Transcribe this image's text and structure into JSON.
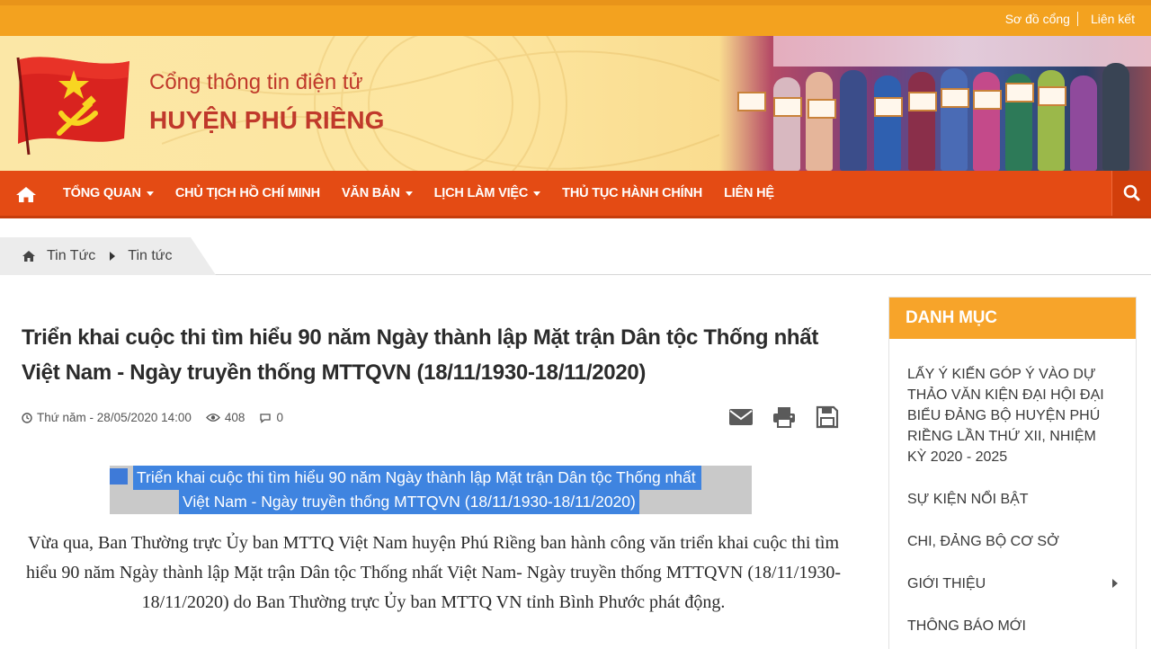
{
  "topbar": {
    "sitemap_label": "Sơ đồ cổng",
    "links_label": "Liên kết"
  },
  "header": {
    "subtitle": "Cổng thông tin điện tử",
    "title": "HUYỆN PHÚ RIỀNG"
  },
  "nav": {
    "items": [
      {
        "label": "TỔNG QUAN",
        "dropdown": true
      },
      {
        "label": "CHỦ TỊCH HỒ CHÍ MINH",
        "dropdown": false
      },
      {
        "label": "VĂN BẢN",
        "dropdown": true
      },
      {
        "label": "LỊCH LÀM VIỆC",
        "dropdown": true
      },
      {
        "label": "THỦ TỤC HÀNH CHÍNH",
        "dropdown": false
      },
      {
        "label": "LIÊN HỆ",
        "dropdown": false
      }
    ],
    "home_icon": "home-icon",
    "search_icon": "search-icon"
  },
  "breadcrumb": {
    "items": [
      "Tin Tức",
      "Tin tức"
    ]
  },
  "article": {
    "title": "Triển khai cuộc thi tìm hiểu 90 năm Ngày thành lập Mặt trận Dân tộc Thống nhất Việt Nam - Ngày truyền thống MTTQVN (18/11/1930-18/11/2020)",
    "date": "Thứ năm - 28/05/2020 14:00",
    "views": "408",
    "comments": "0",
    "highlight_line1": "Triển khai cuộc thi tìm hiểu 90 năm Ngày thành lập Mặt trận Dân tộc Thống nhất",
    "highlight_line2": "Việt Nam - Ngày truyền thống MTTQVN (18/11/1930-18/11/2020)",
    "body": "Vừa qua, Ban Thường trực Ủy ban MTTQ Việt Nam huyện Phú Riềng ban hành công văn triển khai cuộc thi tìm hiểu 90 năm Ngày thành lập Mặt trận Dân tộc Thống nhất Việt Nam- Ngày truyền thống MTTQVN (18/11/1930-18/11/2020) do Ban Thường trực Ủy ban MTTQ VN tỉnh Bình Phước phát động.",
    "highlight_color": "#3f84e0"
  },
  "sidebar": {
    "heading": "DANH MỤC",
    "items": [
      {
        "label": "LẤY Ý KIẾN GÓP Ý VÀO DỰ THẢO VĂN KIỆN ĐẠI HỘI ĐẠI BIỂU ĐẢNG BỘ HUYỆN PHÚ RIỀNG LẦN THỨ XII, NHIỆM KỲ 2020 - 2025",
        "submenu": false
      },
      {
        "label": "SỰ KIỆN NỔI BẬT",
        "submenu": false
      },
      {
        "label": "CHI, ĐẢNG BỘ CƠ SỞ",
        "submenu": false
      },
      {
        "label": "GIỚI THIỆU",
        "submenu": true
      },
      {
        "label": "THÔNG BÁO MỚI",
        "submenu": false
      }
    ]
  },
  "colors": {
    "topbar": "#f3a21f",
    "nav": "#e44b14",
    "accent_red": "#c0392b",
    "sidebar_header": "#f7a42a"
  }
}
